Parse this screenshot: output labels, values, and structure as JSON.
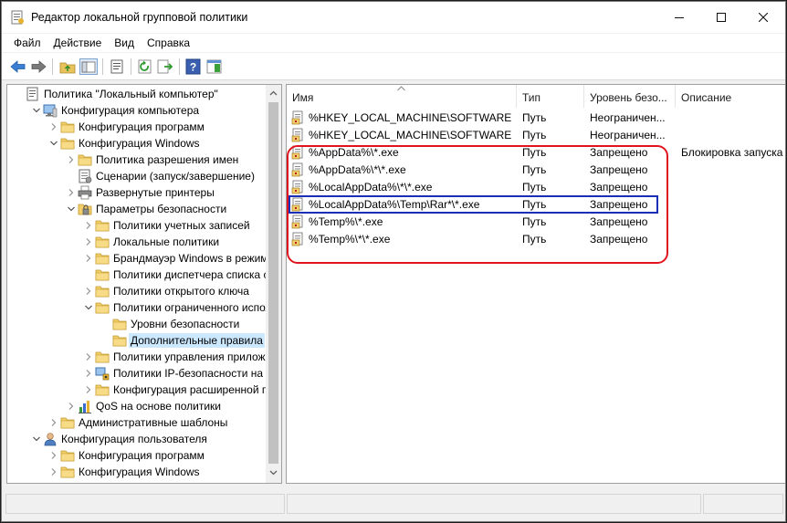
{
  "window": {
    "title": "Редактор локальной групповой политики"
  },
  "menu": [
    "Файл",
    "Действие",
    "Вид",
    "Справка"
  ],
  "tree": {
    "items": [
      {
        "label": "Политика \"Локальный компьютер\"",
        "depth": 0,
        "expander": "none",
        "icon": "computer-policy-icon"
      },
      {
        "label": "Конфигурация компьютера",
        "depth": 1,
        "expander": "open",
        "icon": "computer-icon"
      },
      {
        "label": "Конфигурация программ",
        "depth": 2,
        "expander": "closed",
        "icon": "folder-icon"
      },
      {
        "label": "Конфигурация Windows",
        "depth": 2,
        "expander": "open",
        "icon": "folder-icon"
      },
      {
        "label": "Политика разрешения имен",
        "depth": 3,
        "expander": "closed",
        "icon": "folder-icon"
      },
      {
        "label": "Сценарии (запуск/завершение)",
        "depth": 3,
        "expander": "none",
        "icon": "script-icon"
      },
      {
        "label": "Развернутые принтеры",
        "depth": 3,
        "expander": "closed",
        "icon": "printer-icon"
      },
      {
        "label": "Параметры безопасности",
        "depth": 3,
        "expander": "open",
        "icon": "security-icon"
      },
      {
        "label": "Политики учетных записей",
        "depth": 4,
        "expander": "closed",
        "icon": "folder-icon"
      },
      {
        "label": "Локальные политики",
        "depth": 4,
        "expander": "closed",
        "icon": "folder-icon"
      },
      {
        "label": "Брандмауэр Windows в режиме",
        "depth": 4,
        "expander": "closed",
        "icon": "folder-icon"
      },
      {
        "label": "Политики диспетчера списка се",
        "depth": 4,
        "expander": "none",
        "icon": "folder-icon"
      },
      {
        "label": "Политики открытого ключа",
        "depth": 4,
        "expander": "closed",
        "icon": "folder-icon"
      },
      {
        "label": "Политики ограниченного испол",
        "depth": 4,
        "expander": "open",
        "icon": "folder-icon"
      },
      {
        "label": "Уровни безопасности",
        "depth": 5,
        "expander": "none",
        "icon": "folder-icon"
      },
      {
        "label": "Дополнительные правила",
        "depth": 5,
        "expander": "none",
        "icon": "folder-icon",
        "selected": true
      },
      {
        "label": "Политики управления приложе",
        "depth": 4,
        "expander": "closed",
        "icon": "folder-icon"
      },
      {
        "label": "Политики IP-безопасности на \"Л",
        "depth": 4,
        "expander": "closed",
        "icon": "ipsec-icon"
      },
      {
        "label": "Конфигурация расширенной по",
        "depth": 4,
        "expander": "closed",
        "icon": "folder-icon"
      },
      {
        "label": "QoS на основе политики",
        "depth": 3,
        "expander": "closed",
        "icon": "qos-chart-icon"
      },
      {
        "label": "Административные шаблоны",
        "depth": 2,
        "expander": "closed",
        "icon": "folder-icon"
      },
      {
        "label": "Конфигурация пользователя",
        "depth": 1,
        "expander": "open",
        "icon": "user-icon"
      },
      {
        "label": "Конфигурация программ",
        "depth": 2,
        "expander": "closed",
        "icon": "folder-icon"
      },
      {
        "label": "Конфигурация Windows",
        "depth": 2,
        "expander": "closed",
        "icon": "folder-icon"
      }
    ]
  },
  "list": {
    "columns": [
      "Имя",
      "Тип",
      "Уровень безо...",
      "Описание"
    ],
    "rows": [
      {
        "name": "%HKEY_LOCAL_MACHINE\\SOFTWARE\\...",
        "type": "Путь",
        "level": "Неограничен...",
        "description": ""
      },
      {
        "name": "%HKEY_LOCAL_MACHINE\\SOFTWARE\\...",
        "type": "Путь",
        "level": "Неограничен...",
        "description": ""
      },
      {
        "name": "%AppData%\\*.exe",
        "type": "Путь",
        "level": "Запрещено",
        "description": "Блокировка запуска"
      },
      {
        "name": "%AppData%\\*\\*.exe",
        "type": "Путь",
        "level": "Запрещено",
        "description": ""
      },
      {
        "name": "%LocalAppData%\\*\\*.exe",
        "type": "Путь",
        "level": "Запрещено",
        "description": ""
      },
      {
        "name": "%LocalAppData%\\Temp\\Rar*\\*.exe",
        "type": "Путь",
        "level": "Запрещено",
        "description": ""
      },
      {
        "name": "%Temp%\\*.exe",
        "type": "Путь",
        "level": "Запрещено",
        "description": ""
      },
      {
        "name": "%Temp%\\*\\*.exe",
        "type": "Путь",
        "level": "Запрещено",
        "description": ""
      }
    ]
  },
  "colors": {
    "highlight_red": "#e0141e",
    "highlight_blue": "#1a2fb8",
    "selection": "#cce8ff",
    "folder": "#f2cf6b"
  }
}
